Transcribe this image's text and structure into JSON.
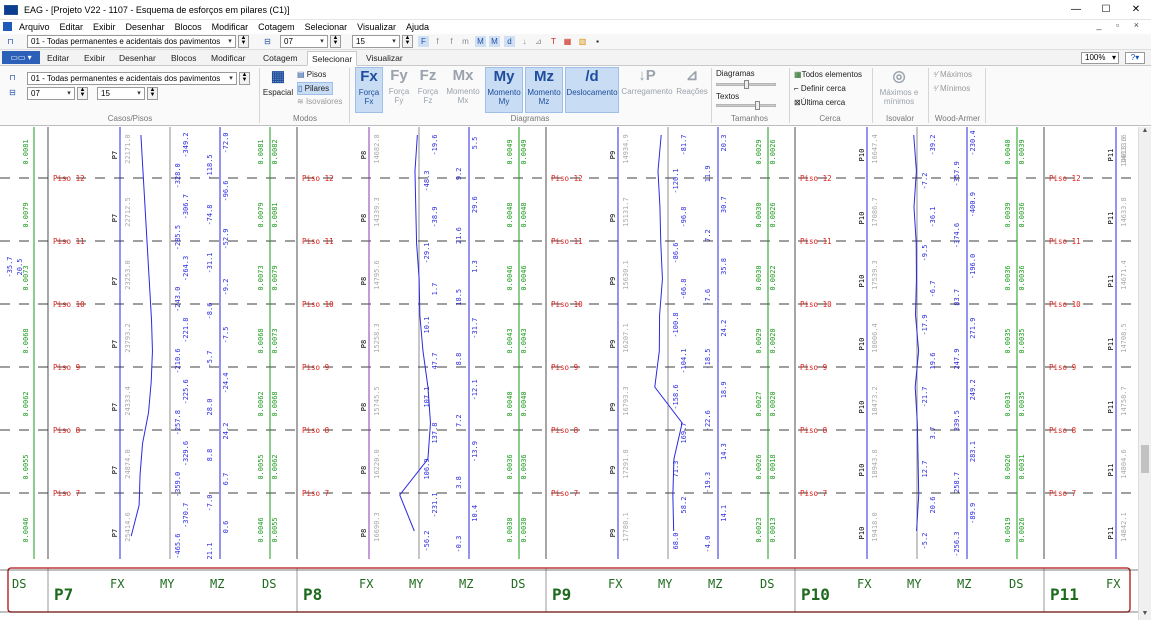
{
  "window": {
    "title": "EAG - [Projeto V22 - 1107 - Esquema de esforços em pilares (C1)]",
    "controls": [
      "—",
      "☐",
      "✕"
    ],
    "mdi_controls": "_ ▫ ×"
  },
  "menu": [
    "Arquivo",
    "Editar",
    "Exibir",
    "Desenhar",
    "Blocos",
    "Modificar",
    "Cotagem",
    "Selecionar",
    "Visualizar",
    "Ajuda"
  ],
  "toolbar": {
    "case_combo": "01 - Todas permanentes e acidentais dos pavimentos",
    "floor_from": "07",
    "floor_to": "15"
  },
  "ribbon_tabs": {
    "file": "▭▭ ▾",
    "tabs": [
      "Editar",
      "Exibir",
      "Desenhar",
      "Blocos",
      "Modificar",
      "Cotagem",
      "Selecionar",
      "Visualizar"
    ],
    "active": "Selecionar",
    "zoom": "100%",
    "help": "?▾"
  },
  "ribbon": {
    "casos": {
      "combo": "01 - Todas permanentes e acidentais dos pavimentos",
      "from": "07",
      "to": "15",
      "label": "Casos/Pisos"
    },
    "modos": {
      "espacial": "Espacial",
      "pisos": "Pisos",
      "pilares": "Pilares",
      "isovalores": "Isovalores",
      "label": "Modos"
    },
    "diagramas": {
      "label": "Diagramas",
      "buttons": [
        {
          "glyph": "Fx",
          "line1": "Força",
          "line2": "Fx",
          "selected": true,
          "dim": false
        },
        {
          "glyph": "Fy",
          "line1": "Força",
          "line2": "Fy",
          "selected": false,
          "dim": true
        },
        {
          "glyph": "Fz",
          "line1": "Força",
          "line2": "Fz",
          "selected": false,
          "dim": true
        },
        {
          "glyph": "Mx",
          "line1": "Momento",
          "line2": "Mx",
          "selected": false,
          "dim": true
        },
        {
          "glyph": "My",
          "line1": "Momento",
          "line2": "My",
          "selected": true,
          "dim": false
        },
        {
          "glyph": "Mz",
          "line1": "Momento",
          "line2": "Mz",
          "selected": true,
          "dim": false
        },
        {
          "glyph": "/d",
          "line1": "Deslocamento",
          "line2": "",
          "selected": true,
          "dim": false
        },
        {
          "glyph": "↓P",
          "line1": "Carregamento",
          "line2": "",
          "selected": false,
          "dim": true
        },
        {
          "glyph": "⊿",
          "line1": "Reações",
          "line2": "",
          "selected": false,
          "dim": true
        }
      ]
    },
    "tamanhos": {
      "diagramas": "Diagramas",
      "textos": "Textos",
      "label": "Tamanhos"
    },
    "cerca": {
      "todos": "Todos elementos",
      "definir": "Definir cerca",
      "ultima": "Última cerca",
      "label": "Cerca"
    },
    "isovalor": {
      "maximos_minimos_1": "Máximos e",
      "maximos_minimos_2": "mínimos",
      "label": "Isovalor"
    },
    "wood_armer": {
      "maximos": "Máximos",
      "minimos": "Mínimos",
      "label": "Wood-Armer"
    }
  },
  "drawing": {
    "floors": [
      "Piso 12",
      "Piso 11",
      "Piso 10",
      "Piso 9",
      "Piso 8",
      "Piso 7"
    ],
    "columns": [
      "P7",
      "P8",
      "P9",
      "P10",
      "P11"
    ],
    "header_labels": [
      "DS",
      "FX",
      "MY",
      "MZ",
      "DS"
    ],
    "colors": {
      "floor_label": "#e0201a",
      "fx_line": "#2a2ae0",
      "fx_line_p8": "#8a3ab0",
      "moment_line": "#2a2ae0",
      "ds_line": "#1a9a1a",
      "header_text": "#1e6b1e",
      "frame": "#b01010",
      "faint_text": "#a8a8a8"
    },
    "fx_values": {
      "P7": [
        "22171.0",
        "22712.5",
        "23253.0",
        "23793.2",
        "24333.4",
        "24874.0",
        "25414.6"
      ],
      "P8": [
        "14682.8",
        "14339.3",
        "14795.6",
        "15258.3",
        "15745.5",
        "16220.0",
        "16690.3"
      ],
      "P9": [
        "14934.9",
        "15131.7",
        "15630.1",
        "16207.1",
        "16793.3",
        "17291.8",
        "17780.1"
      ],
      "P10": [
        "16647.4",
        "17086.7",
        "17539.3",
        "18006.4",
        "18473.2",
        "18943.8",
        "19418.0"
      ],
      "P11": [
        "14613.6",
        "14633.8",
        "14671.4",
        "14708.5",
        "14758.7",
        "14804.6",
        "14842.1"
      ]
    },
    "my_values": {
      "P7": [
        "-349.2",
        "-328.0",
        "-306.7",
        "-285.5",
        "-264.3",
        "-243.0",
        "-221.8",
        "-210.6",
        "-225.6",
        "-257.8",
        "-329.6",
        "-359.0",
        "-370.7",
        "-465.6"
      ],
      "P8": [
        "-19.6",
        "-48.3",
        "-38.9",
        "-29.1",
        "1.7",
        "10.1",
        "47.7",
        "107.1",
        "137.8",
        "106.9",
        "-231.1",
        "-56.2"
      ],
      "P9": [
        "-81.7",
        "-120.1",
        "-96.8",
        "-86.6",
        "-66.8",
        "-100.8",
        "-104.1",
        "-158.6",
        "169.7",
        "71.3",
        "58.2",
        "68.0"
      ],
      "P10": [
        "-39.2",
        "-7.2",
        "-36.1",
        "-9.5",
        "-6.7",
        "-17.9",
        "19.6",
        "-21.7",
        "3.7",
        "12.7",
        "20.6",
        "-5.2"
      ],
      "P11": []
    },
    "mz_values": {
      "P7": [
        "-72.0",
        "-118.5",
        "-96.6",
        "-74.8",
        "-52.9",
        "-31.1",
        "-9.2",
        "-8.6",
        "-7.5",
        "-5.7",
        "-24.4",
        "28.0",
        "24.2",
        "8.8",
        "6.7",
        "-7.0",
        "0.6",
        "21.1"
      ],
      "P8": [
        "5.5",
        "9.2",
        "29.6",
        "21.6",
        "1.3",
        "18.5",
        "-31.7",
        "8.8",
        "-12.1",
        "7.2",
        "-13.9",
        "3.8",
        "10.4",
        "-0.3"
      ],
      "P9": [
        "20.3",
        "11.9",
        "30.7",
        "7.2",
        "35.8",
        "-7.6",
        "24.2",
        "-18.5",
        "18.9",
        "-22.6",
        "14.3",
        "-19.3",
        "14.1",
        "-4.0"
      ],
      "P10": [
        "-230.4",
        "-357.9",
        "-400.9",
        "-374.6",
        "-196.0",
        "83.7",
        "271.9",
        "247.9",
        "249.2",
        "339.5",
        "283.1",
        "258.7",
        "-89.9",
        "-256.3"
      ],
      "P11": []
    },
    "ds_values": {
      "P7_left": [
        "0.0081",
        "0.0079",
        "0.0073",
        "0.0068",
        "0.0062",
        "0.0055",
        "0.0046"
      ],
      "P7_right": [
        "0.0082",
        "0.0081",
        "0.0079",
        "0.0073",
        "0.0068",
        "0.0062",
        "0.0055"
      ],
      "P8_left": [
        "0.0049",
        "0.0048",
        "0.0046",
        "0.0043",
        "0.0040",
        "0.0036",
        "0.0030"
      ],
      "P8_right": [
        "0.0049",
        "0.0048",
        "0.0046",
        "0.0043",
        "0.0040",
        "0.0036",
        "0.0030"
      ],
      "P9_left": [
        "0.0029",
        "0.0030",
        "0.0030",
        "0.0029",
        "0.0027",
        "0.0026",
        "0.0023"
      ],
      "P9_right": [
        "0.0026",
        "0.0026",
        "0.0022",
        "0.0020",
        "0.0020",
        "0.0018",
        "0.0013"
      ],
      "P10_left": [
        "0.0040",
        "0.0039",
        "0.0036",
        "0.0035",
        "0.0031",
        "0.0026",
        "0.0019"
      ],
      "P10_right": [
        "0.0039",
        "0.0036",
        "0.0036",
        "0.0035",
        "0.0035",
        "0.0031",
        "0.0026"
      ]
    },
    "left_cut_values": [
      "-35.7",
      "20.5"
    ],
    "p11_right_values": [
      "14613.6"
    ]
  }
}
